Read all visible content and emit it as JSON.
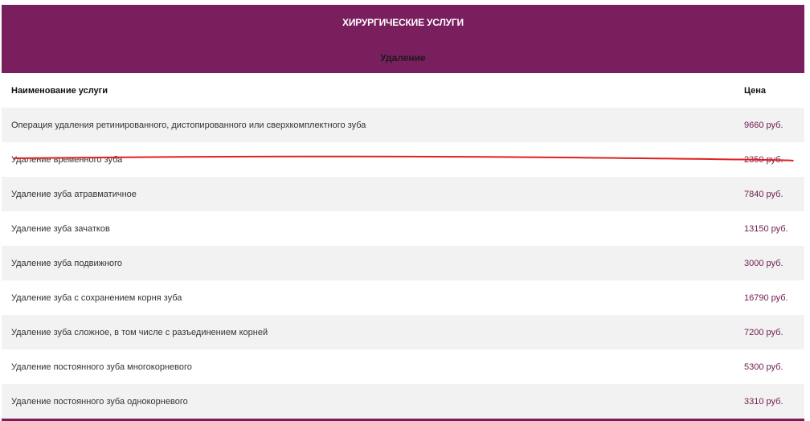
{
  "table": {
    "title": "ХИРУРГИЧЕСКИЕ УСЛУГИ",
    "subtitle": "Удаление",
    "columns": {
      "name": "Наименование услуги",
      "price": "Цена"
    },
    "rows": [
      {
        "name": "Операция удаления ретинированного, дистопированного или сверхкомплектного зуба",
        "price": "9660 руб."
      },
      {
        "name": "Удаление временного зуба",
        "price": "2350 руб."
      },
      {
        "name": "Удаление зуба атравматичное",
        "price": "7840 руб."
      },
      {
        "name": "Удаление зуба зачатков",
        "price": "13150 руб."
      },
      {
        "name": "Удаление зуба подвижного",
        "price": "3000 руб."
      },
      {
        "name": "Удаление зуба с сохранением корня зуба",
        "price": "16790 руб."
      },
      {
        "name": "Удаление зуба сложное, в том числе с разъединением корней",
        "price": "7200 руб."
      },
      {
        "name": "Удаление постоянного зуба многокорневого",
        "price": "5300 руб."
      },
      {
        "name": "Удаление постоянного зуба однокорневого",
        "price": "3310 руб."
      }
    ]
  },
  "colors": {
    "header_bg": "#7a1f5e",
    "price_text": "#6e1a50",
    "row_alt_bg": "#f2f2f2",
    "strike_line": "#e02020"
  },
  "annotation": {
    "strikethrough_row": 1
  }
}
